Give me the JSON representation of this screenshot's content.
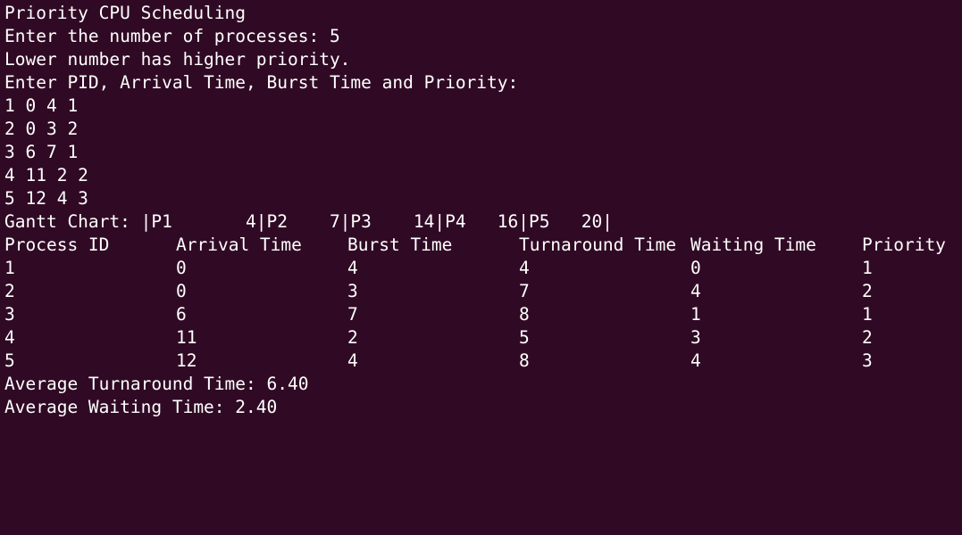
{
  "terminal": {
    "title_line": "Priority CPU Scheduling",
    "prompt_count": "Enter the number of processes: 5",
    "priority_note": "Lower number has higher priority.",
    "prompt_input": "Enter PID, Arrival Time, Burst Time and Priority:",
    "inputs": [
      "1 0 4 1",
      "2 0 3 2",
      "3 6 7 1",
      "4 11 2 2",
      "5 12 4 3"
    ],
    "gantt_line": "Gantt Chart: |P1       4|P2    7|P3    14|P4   16|P5   20|",
    "table": {
      "headers": [
        "Process ID",
        "Arrival Time",
        "Burst Time",
        "Turnaround Time",
        "Waiting Time",
        "Priority"
      ],
      "rows": [
        [
          "1",
          "0",
          "4",
          "4",
          "0",
          "1"
        ],
        [
          "2",
          "0",
          "3",
          "7",
          "4",
          "2"
        ],
        [
          "3",
          "6",
          "7",
          "8",
          "1",
          "1"
        ],
        [
          "4",
          "11",
          "2",
          "5",
          "3",
          "2"
        ],
        [
          "5",
          "12",
          "4",
          "8",
          "4",
          "3"
        ]
      ]
    },
    "avg_turnaround": "Average Turnaround Time: 6.40",
    "avg_waiting": "Average Waiting Time: 2.40"
  },
  "colors": {
    "background": "#300a24",
    "foreground": "#ffffff"
  }
}
